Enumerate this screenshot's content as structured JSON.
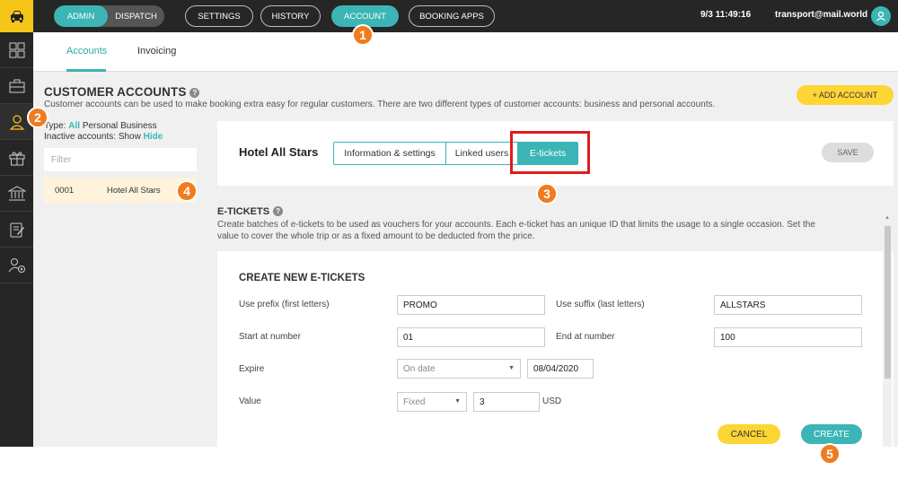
{
  "topbar": {
    "mode_switch": {
      "active": "ADMIN",
      "inactive": "DISPATCH"
    },
    "nav": [
      "SETTINGS",
      "HISTORY",
      "ACCOUNT",
      "BOOKING APPS"
    ],
    "active_nav": "ACCOUNT",
    "datetime": "9/3 11:49:16",
    "user_email": "transport@mail.world"
  },
  "subnav": {
    "tabs": [
      "Accounts",
      "Invoicing"
    ],
    "active": "Accounts"
  },
  "page": {
    "title": "CUSTOMER ACCOUNTS",
    "description": "Customer accounts can be used to make booking extra easy for regular customers. There are two different types of customer accounts: business and personal accounts.",
    "add_button": "+ ADD ACCOUNT"
  },
  "filters": {
    "type_label": "Type:",
    "type_options": [
      "All",
      "Personal",
      "Business"
    ],
    "type_selected": "All",
    "inactive_label": "Inactive accounts:",
    "inactive_options": [
      "Show",
      "Hide"
    ],
    "inactive_selected": "Hide",
    "filter_placeholder": "Filter"
  },
  "accounts": [
    {
      "id": "0001",
      "name": "Hotel All Stars"
    }
  ],
  "account_panel": {
    "name": "Hotel All Stars",
    "tabs": [
      "Information & settings",
      "Linked users",
      "E-tickets"
    ],
    "active_tab": "E-tickets",
    "save": "SAVE"
  },
  "etickets": {
    "title": "E-TICKETS",
    "description": "Create batches of e-tickets to be used as vouchers for your accounts. Each e-ticket has an unique ID that limits the usage to a single occasion. Set the value to cover the whole trip or as a fixed amount to be deducted from the price."
  },
  "create_form": {
    "title": "CREATE NEW E-TICKETS",
    "prefix_label": "Use prefix (first letters)",
    "prefix_value": "PROMO",
    "suffix_label": "Use suffix (last letters)",
    "suffix_value": "ALLSTARS",
    "start_label": "Start at number",
    "start_value": "01",
    "end_label": "End at number",
    "end_value": "100",
    "expire_label": "Expire",
    "expire_select": "On date",
    "expire_date": "08/04/2020",
    "value_label": "Value",
    "value_select": "Fixed",
    "value_amount": "3",
    "currency": "USD",
    "cancel": "CANCEL",
    "create": "CREATE"
  },
  "markers": [
    "1",
    "2",
    "3",
    "4",
    "5"
  ],
  "colors": {
    "accent": "#3bb5b5",
    "yellow": "#fdd535",
    "marker": "#f07c1f",
    "highlight": "#e01b1b",
    "dark": "#262626"
  },
  "icons": {
    "logo": "taxi-icon",
    "sidebar": [
      "grid-icon",
      "briefcase-icon",
      "customer-icon",
      "gift-icon",
      "bank-icon",
      "edit-document-icon",
      "user-settings-icon"
    ],
    "user": "user-icon",
    "help": "help-icon"
  }
}
